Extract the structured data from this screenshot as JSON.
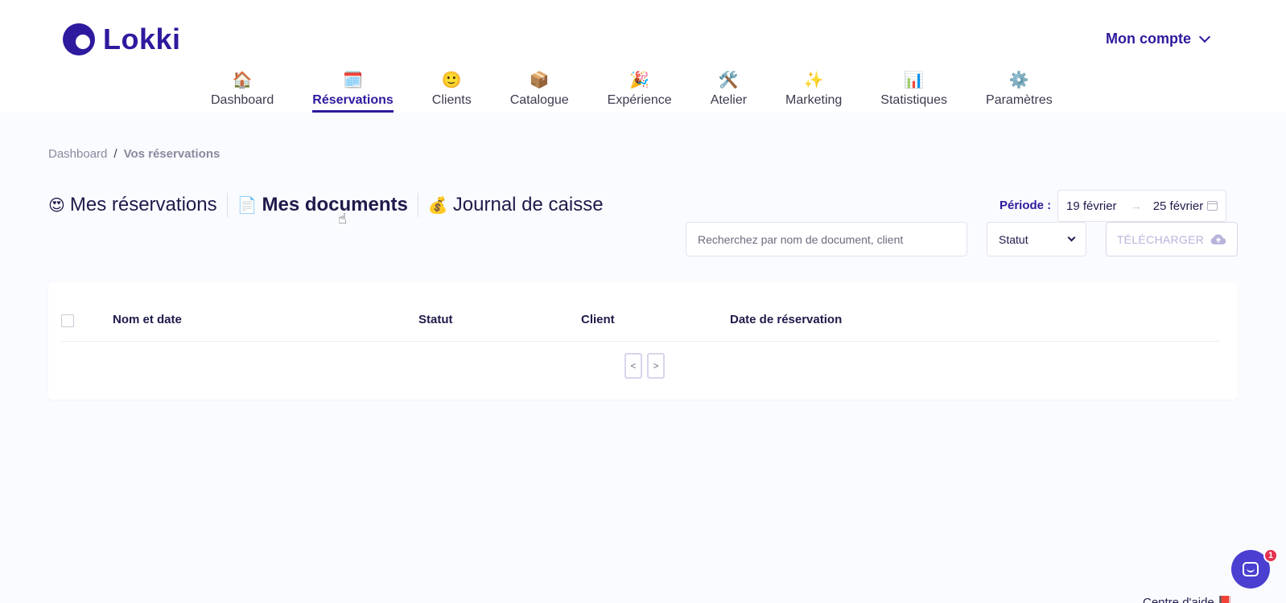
{
  "header": {
    "logo_text": "Lokki",
    "account_label": "Mon compte"
  },
  "nav": {
    "items": [
      {
        "emoji": "🏠",
        "label": "Dashboard"
      },
      {
        "emoji": "🗓️",
        "label": "Réservations"
      },
      {
        "emoji": "🙂",
        "label": "Clients"
      },
      {
        "emoji": "📦",
        "label": "Catalogue"
      },
      {
        "emoji": "🎉",
        "label": "Expérience"
      },
      {
        "emoji": "🛠️",
        "label": "Atelier"
      },
      {
        "emoji": "✨",
        "label": "Marketing"
      },
      {
        "emoji": "📊",
        "label": "Statistiques"
      },
      {
        "emoji": "⚙️",
        "label": "Paramètres"
      }
    ],
    "active": "Réservations"
  },
  "breadcrumb": {
    "root": "Dashboard",
    "separator": "/",
    "current": "Vos réservations"
  },
  "tabs": [
    {
      "emoji": "😍",
      "label": "Mes réservations"
    },
    {
      "emoji": "📄",
      "label": "Mes documents"
    },
    {
      "emoji": "💰",
      "label": "Journal de caisse"
    }
  ],
  "period": {
    "label": "Période :",
    "start": "19 février",
    "end": "25 février",
    "arrow": "→"
  },
  "filters": {
    "search_placeholder": "Recherchez par nom de document, client",
    "status_label": "Statut",
    "download_label": "TÉLÉCHARGER"
  },
  "table": {
    "columns": [
      "Nom et date",
      "Statut",
      "Client",
      "Date de réservation"
    ],
    "rows": [],
    "prev": "<",
    "next": ">"
  },
  "support": {
    "badge_count": "1",
    "help_label": "Centre d'aide 📕"
  },
  "colors": {
    "brand": "#2e1a9e",
    "background": "#fafbfe",
    "disabled": "#b7b4dc",
    "badge": "#e5304f",
    "chat": "#4a3fd1"
  }
}
